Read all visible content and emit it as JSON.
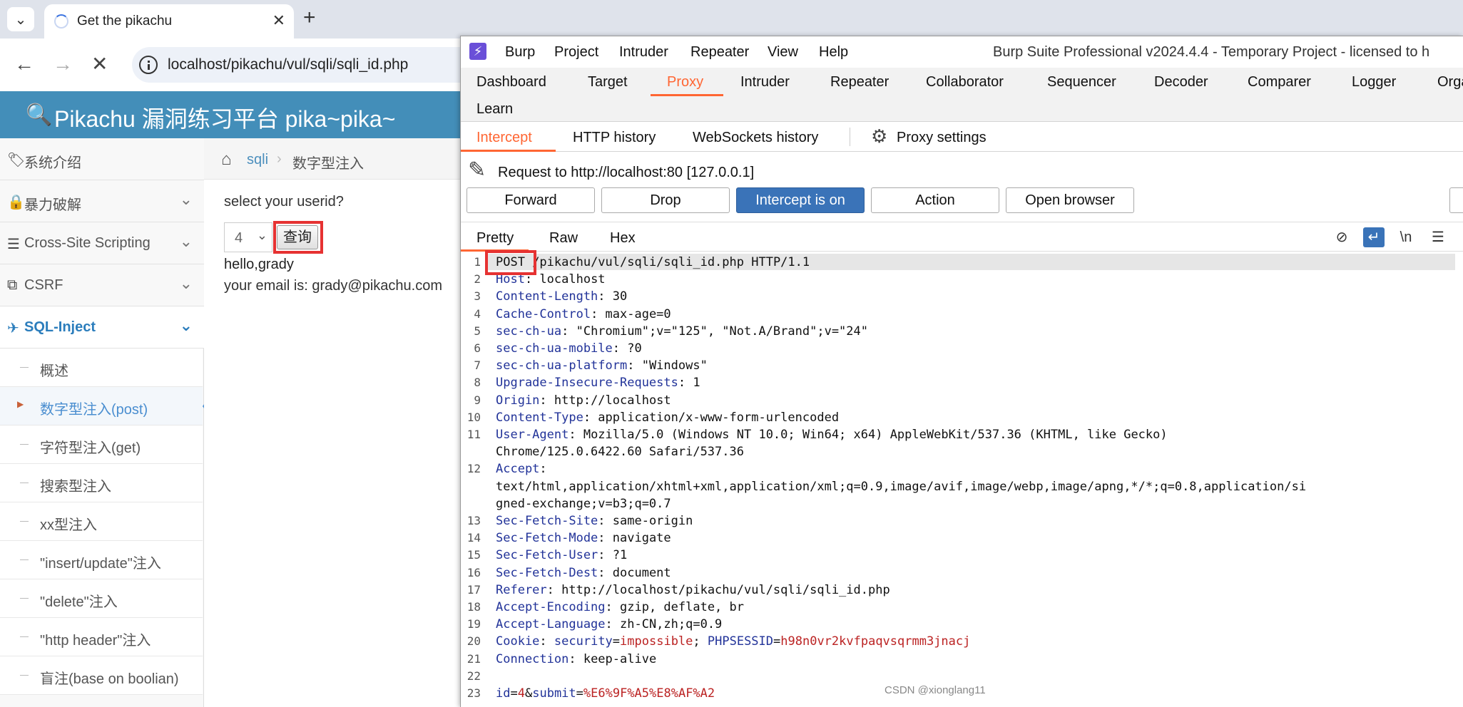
{
  "browser": {
    "tab_title": "Get the pikachu",
    "url": "localhost/pikachu/vul/sqli/sqli_id.php"
  },
  "pikachu": {
    "header_title": "Pikachu 漏洞练习平台 pika~pika~",
    "sidebar": [
      {
        "label": "系统介绍",
        "icon": "tags-icon"
      },
      {
        "label": "暴力破解",
        "icon": "lock-icon"
      },
      {
        "label": "Cross-Site Scripting",
        "icon": "list-icon"
      },
      {
        "label": "CSRF",
        "icon": "external-link-icon"
      },
      {
        "label": "SQL-Inject",
        "icon": "plane-icon"
      }
    ],
    "submenu": [
      "概述",
      "数字型注入(post)",
      "字符型注入(get)",
      "搜索型注入",
      "xx型注入",
      "\"insert/update\"注入",
      "\"delete\"注入",
      "\"http header\"注入",
      "盲注(base on boolian)"
    ],
    "breadcrumb": {
      "link": "sqli",
      "current": "数字型注入"
    },
    "question": "select your userid?",
    "select_value": "4",
    "query_button": "查询",
    "output_line1": "hello,grady",
    "output_line2": "your email is: grady@pikachu.com"
  },
  "burp": {
    "menu": [
      "Burp",
      "Project",
      "Intruder",
      "Repeater",
      "View",
      "Help"
    ],
    "window_title": "Burp Suite Professional v2024.4.4 - Temporary Project - licensed to h",
    "main_tabs_row1": [
      "Dashboard",
      "Target",
      "Proxy",
      "Intruder",
      "Repeater",
      "Collaborator",
      "Sequencer",
      "Decoder",
      "Comparer",
      "Logger",
      "Orga"
    ],
    "main_tabs_row2": [
      "Learn"
    ],
    "active_main_tab": "Proxy",
    "sub_tabs": [
      "Intercept",
      "HTTP history",
      "WebSockets history"
    ],
    "proxy_settings": "Proxy settings",
    "request_to": "Request to http://localhost:80  [127.0.0.1]",
    "buttons": {
      "forward": "Forward",
      "drop": "Drop",
      "intercept": "Intercept is on",
      "action": "Action",
      "open_browser": "Open browser"
    },
    "editor_tabs": [
      "Pretty",
      "Raw",
      "Hex"
    ],
    "request_lines": [
      {
        "n": "1",
        "text": " /pikachu/vul/sqli/sqli_id.php HTTP/1.1",
        "method": "POST"
      },
      {
        "n": "2",
        "name": "Host",
        "value": "localhost"
      },
      {
        "n": "3",
        "name": "Content-Length",
        "value": "30"
      },
      {
        "n": "4",
        "name": "Cache-Control",
        "value": "max-age=0"
      },
      {
        "n": "5",
        "name": "sec-ch-ua",
        "value": "\"Chromium\";v=\"125\", \"Not.A/Brand\";v=\"24\""
      },
      {
        "n": "6",
        "name": "sec-ch-ua-mobile",
        "value": "?0"
      },
      {
        "n": "7",
        "name": "sec-ch-ua-platform",
        "value": "\"Windows\""
      },
      {
        "n": "8",
        "name": "Upgrade-Insecure-Requests",
        "value": "1"
      },
      {
        "n": "9",
        "name": "Origin",
        "value": "http://localhost"
      },
      {
        "n": "10",
        "name": "Content-Type",
        "value": "application/x-www-form-urlencoded"
      },
      {
        "n": "11",
        "name": "User-Agent",
        "value": "Mozilla/5.0 (Windows NT 10.0; Win64; x64) AppleWebKit/537.36 (KHTML, like Gecko)",
        "cont": "Chrome/125.0.6422.60 Safari/537.36"
      },
      {
        "n": "12",
        "name": "Accept",
        "value": "",
        "cont": "text/html,application/xhtml+xml,application/xml;q=0.9,image/avif,image/webp,image/apng,*/*;q=0.8,application/si",
        "cont2": "gned-exchange;v=b3;q=0.7"
      },
      {
        "n": "13",
        "name": "Sec-Fetch-Site",
        "value": "same-origin"
      },
      {
        "n": "14",
        "name": "Sec-Fetch-Mode",
        "value": "navigate"
      },
      {
        "n": "15",
        "name": "Sec-Fetch-User",
        "value": "?1"
      },
      {
        "n": "16",
        "name": "Sec-Fetch-Dest",
        "value": "document"
      },
      {
        "n": "17",
        "name": "Referer",
        "value": "http://localhost/pikachu/vul/sqli/sqli_id.php"
      },
      {
        "n": "18",
        "name": "Accept-Encoding",
        "value": "gzip, deflate, br"
      },
      {
        "n": "19",
        "name": "Accept-Language",
        "value": "zh-CN,zh;q=0.9"
      },
      {
        "n": "20",
        "name": "Cookie",
        "cookie1_name": "security",
        "cookie1_value": "impossible",
        "cookie2_name": "PHPSESSID",
        "cookie2_value": "h98n0vr2kvfpaqvsqrmm3jnacj"
      },
      {
        "n": "21",
        "name": "Connection",
        "value": "keep-alive"
      },
      {
        "n": "22"
      },
      {
        "n": "23",
        "body_k1": "id",
        "body_v1": "4",
        "body_k2": "submit",
        "body_v2": "%E6%9F%A5%E8%AF%A2"
      }
    ]
  },
  "watermark": "CSDN @xionglang11",
  "colors": {
    "accent": "#ff6633",
    "pikachu_header": "#438eb9",
    "intercept_on": "#3a73b8",
    "highlight_box": "#e63232"
  }
}
